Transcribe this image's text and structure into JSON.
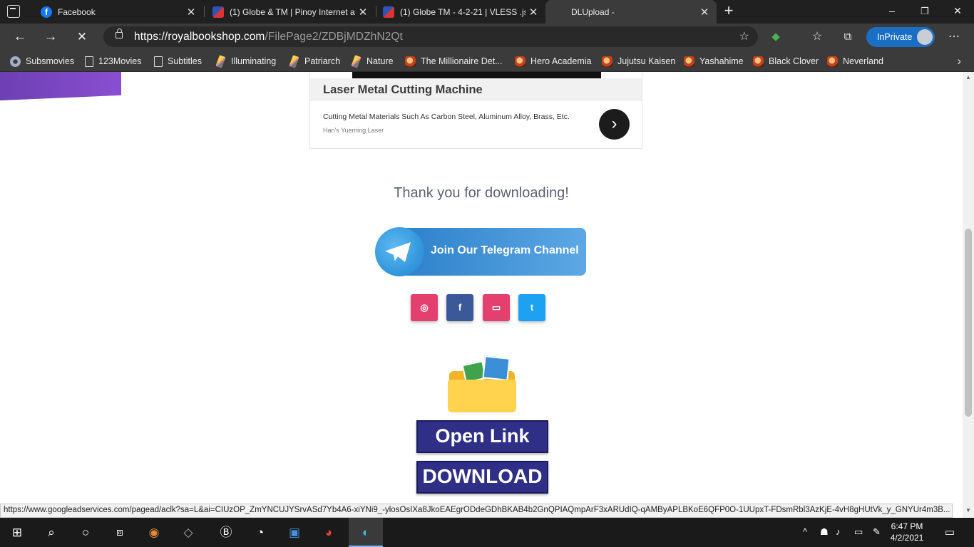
{
  "tabs": [
    {
      "title": "Facebook",
      "favicon": "facebook-icon",
      "color": "#1877f2",
      "active": false
    },
    {
      "title": "(1) Globe & TM | Pinoy Internet a",
      "favicon": "shield-logo-icon",
      "color": "#c9d4f0",
      "active": false
    },
    {
      "title": "(1) Globe TM - 4-2-21 | VLESS .js",
      "favicon": "shield-logo-icon",
      "color": "#c9d4f0",
      "active": false
    },
    {
      "title": "DLUpload -",
      "favicon": "",
      "color": "",
      "active": true
    }
  ],
  "window": {
    "minimize": "–",
    "maximize": "❐",
    "close": "✕"
  },
  "address": {
    "host": "https://royalbookshop.com",
    "path": "/FilePage2/ZDBjMDZhN2Qt"
  },
  "profile": {
    "label": "InPrivate"
  },
  "bookmarks": [
    {
      "label": "Subsmovies",
      "icon": "gear-icon"
    },
    {
      "label": "123Movies",
      "icon": "page-icon"
    },
    {
      "label": "Subtitles",
      "icon": "page-icon"
    },
    {
      "label": "Illuminating",
      "icon": "pencil-icon"
    },
    {
      "label": "Patriarch",
      "icon": "pencil-icon"
    },
    {
      "label": "Nature",
      "icon": "pencil-icon"
    },
    {
      "label": "The Millionaire Det...",
      "icon": "anime-icon"
    },
    {
      "label": "Hero Academia",
      "icon": "anime-icon"
    },
    {
      "label": "Jujutsu Kaisen",
      "icon": "anime-icon"
    },
    {
      "label": "Yashahime",
      "icon": "anime-icon"
    },
    {
      "label": "Black Clover",
      "icon": "anime-icon"
    },
    {
      "label": "Neverland",
      "icon": "anime-icon"
    }
  ],
  "ad": {
    "title": "Laser Metal Cutting Machine",
    "description": "Cutting Metal Materials Such As Carbon Steel, Aluminum Alloy, Brass, Etc.",
    "source": "Han's Yueming Laser"
  },
  "page": {
    "thanks": "Thank you for downloading!",
    "telegram": "Join Our Telegram Channel",
    "open_link": "Open Link",
    "download": "DOWNLOAD"
  },
  "social": [
    {
      "name": "instagram",
      "glyph": "◎",
      "color": "#e4406f"
    },
    {
      "name": "facebook",
      "glyph": "f",
      "color": "#3b5998"
    },
    {
      "name": "youtube",
      "glyph": "▭",
      "color": "#e4406f"
    },
    {
      "name": "twitter",
      "glyph": "t",
      "color": "#1da1f2"
    }
  ],
  "status_url": "https://www.googleadservices.com/pagead/aclk?sa=L&ai=CIUzOP_ZmYNCUJYSrvASd7Yb4A6-xiYNi9_-ylosOsIXa8JkoEAEgrODdeGDhBKAB4b2GnQPIAQmpArF3xARUdIQ-qAMByAPLBKoE6QFP0O-1UUpxT-FDsmRbl3AzKjE-4vH8gHUtVk_y_GNYUr4m3B...",
  "clock": {
    "time": "6:47 PM",
    "date": "4/2/2021"
  }
}
